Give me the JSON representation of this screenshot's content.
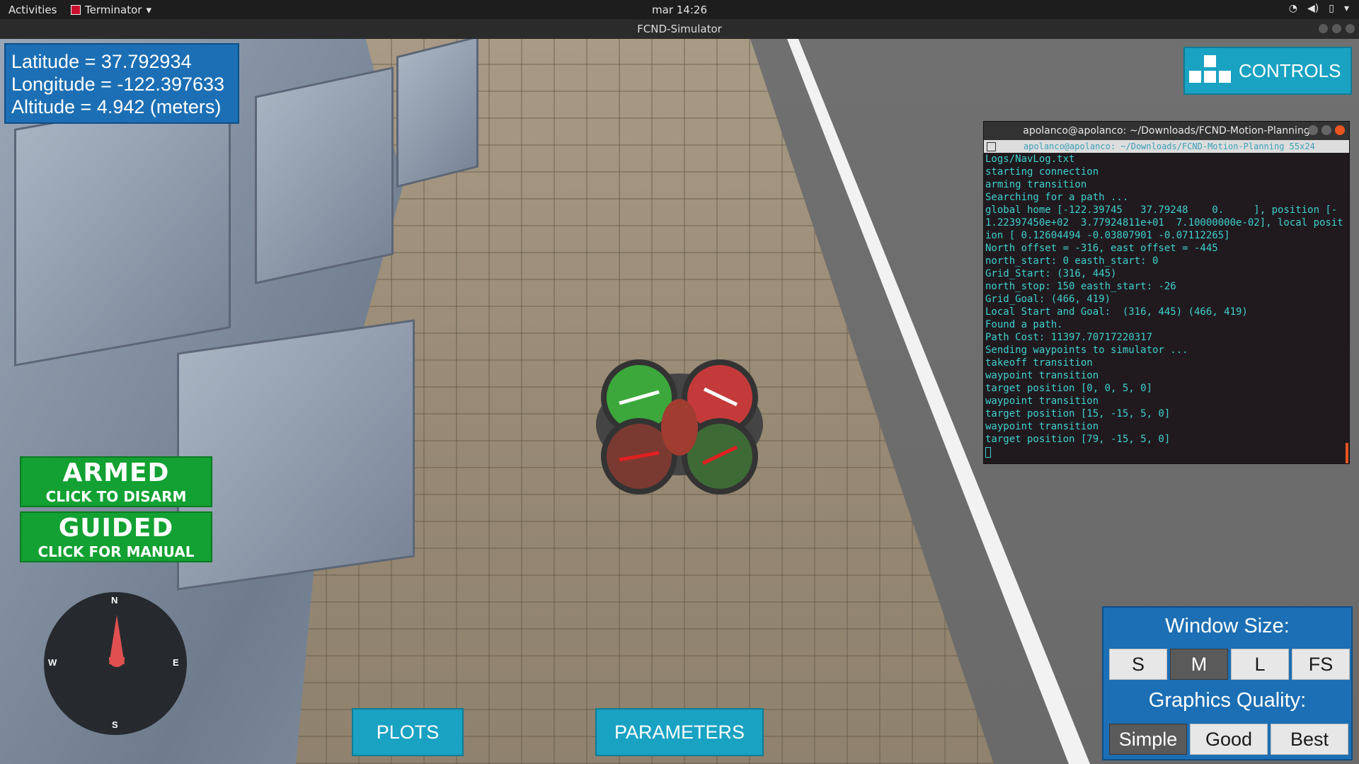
{
  "topbar": {
    "activities": "Activities",
    "app_name": "Terminator",
    "clock": "mar 14:26",
    "tray_icons": [
      "wifi-icon",
      "volume-icon",
      "battery-icon",
      "chevron-down-icon"
    ]
  },
  "window": {
    "title": "FCND-Simulator"
  },
  "hud": {
    "latitude": "Latitude = 37.792934",
    "longitude": "Longitude = -122.397633",
    "altitude": "Altitude = 4.942 (meters)",
    "controls_label": "CONTROLS",
    "armed_title": "ARMED",
    "armed_sub": "CLICK TO DISARM",
    "guided_title": "GUIDED",
    "guided_sub": "CLICK FOR MANUAL",
    "compass": {
      "n": "N",
      "e": "E",
      "s": "S",
      "w": "W"
    },
    "plots_label": "PLOTS",
    "parameters_label": "PARAMETERS"
  },
  "window_size": {
    "heading": "Window Size:",
    "options": [
      "S",
      "M",
      "L",
      "FS"
    ],
    "selected": "M",
    "graphics_heading": "Graphics Quality:",
    "quality_options": [
      "Simple",
      "Good",
      "Best"
    ],
    "quality_selected": "Simple"
  },
  "terminal": {
    "title": "apolanco@apolanco: ~/Downloads/FCND-Motion-Planning",
    "tab": "apolanco@apolanco: ~/Downloads/FCND-Motion-Planning 55x24",
    "lines": "Logs/NavLog.txt\nstarting connection\narming transition\nSearching for a path ...\nglobal home [-122.39745   37.79248    0.     ], position [-1.22397450e+02  3.77924811e+01  7.10000000e-02], local position [ 0.12604494 -0.03807901 -0.07112265]\nNorth offset = -316, east offset = -445\nnorth_start: 0 easth_start: 0\nGrid_Start: (316, 445)\nnorth_stop: 150 easth_start: -26\nGrid_Goal: (466, 419)\nLocal Start and Goal:  (316, 445) (466, 419)\nFound a path.\nPath Cost: 11397.70717220317\nSending waypoints to simulator ...\ntakeoff transition\nwaypoint transition\ntarget position [0, 0, 5, 0]\nwaypoint transition\ntarget position [15, -15, 5, 0]\nwaypoint transition\ntarget position [79, -15, 5, 0]"
  }
}
